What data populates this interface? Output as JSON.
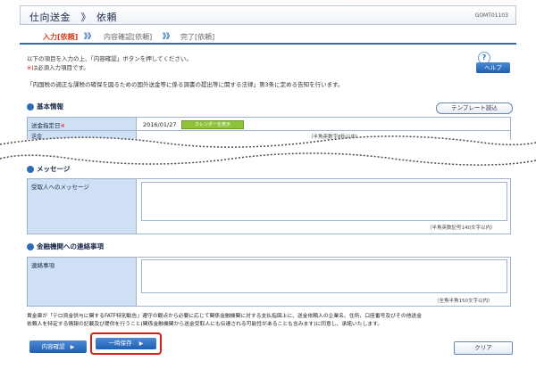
{
  "header": {
    "title": "仕向送金　》　依頼",
    "screen_id": "GOMT01103"
  },
  "steps": [
    {
      "label": "入力[依頼]"
    },
    {
      "label": "内容確認[依頼]"
    },
    {
      "label": "完了[依頼]"
    }
  ],
  "step_arrow": "》》",
  "intro": {
    "line1": "以下の項目を入力の上、「内容確認」ボタンを押してください。",
    "line2_mark": "※",
    "line2_text": "は必須入力項目です。",
    "law_notice": "「内国税の適正な課税の確保を図るための国外送金等に係る調書の提出等に関する法律」第3条に定める告知を行います。"
  },
  "help": {
    "icon": "question-icon",
    "label": "ヘルプ"
  },
  "basic_info": {
    "heading": "基本情報",
    "template_button": "テンプレート読込",
    "date_label": "送金指定日",
    "date_mark": "※",
    "date_value": "2016/01/27",
    "calendar_button": "カレンダーを表示",
    "partial_label": "送金",
    "partial_value": "（半角英数字8桁以内）"
  },
  "message": {
    "heading": "メッセージ",
    "label": "受取人へのメッセージ",
    "note": "（半角英数記号140文字以内）"
  },
  "contact": {
    "heading": "金融機関への連絡事項",
    "label": "連絡事項",
    "note": "（全角半角150文字以内）"
  },
  "notice": {
    "line1": "貴金庫が「テロ資金供与に関するFATF特別勧告」遵守の観点から必要に応じて関係金融機関に対する支払指図上に、送金依頼人の企業名、住所、口座番号及びその他送金",
    "line2": "依頼人を特定する情報の記載及び提供を行うこと(関係金融機関から送金受取人にも伝達される可能性があることも含みます)に同意し、承諾いたします。"
  },
  "buttons": {
    "confirm": "内容確認",
    "temp_save": "一時保存",
    "clear": "クリア",
    "arrow": "▶"
  }
}
